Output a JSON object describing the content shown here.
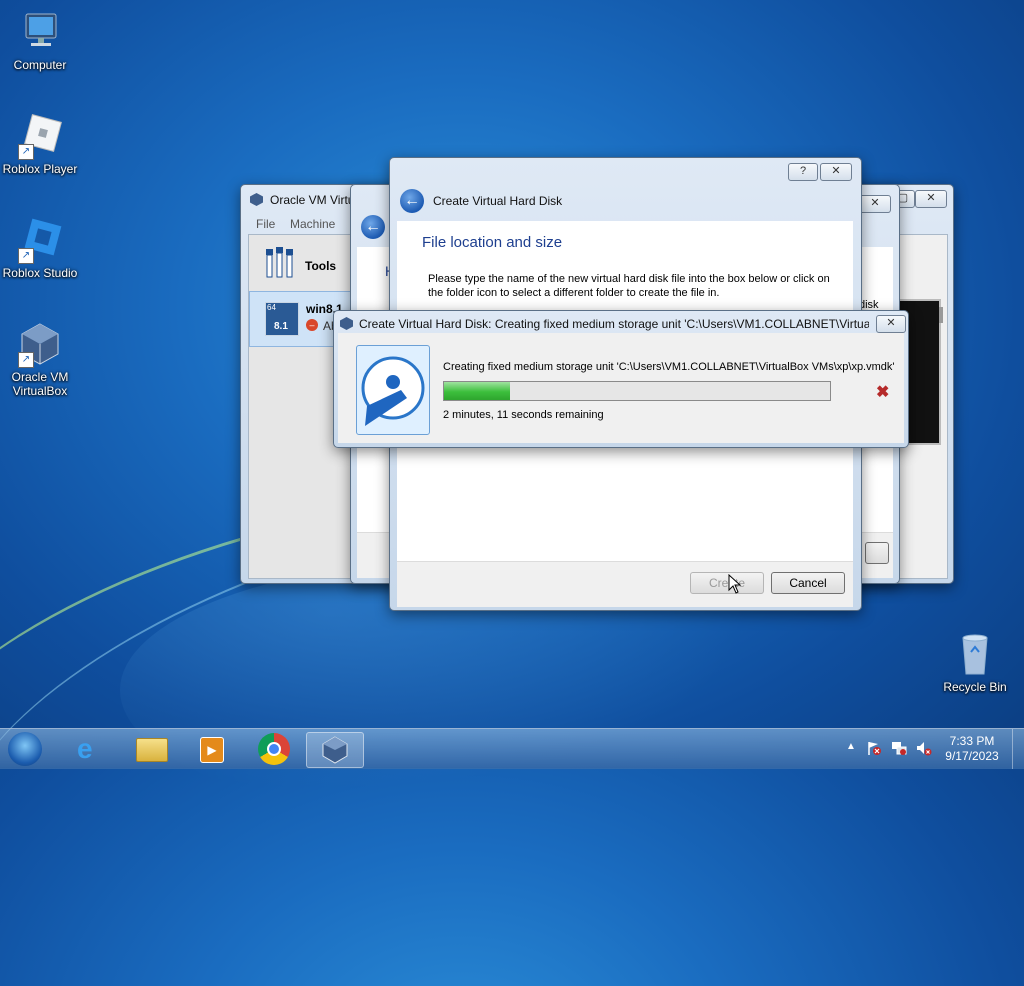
{
  "desktop": {
    "icons": [
      {
        "label": "Computer"
      },
      {
        "label": "Roblox Player"
      },
      {
        "label": "Roblox Studio"
      },
      {
        "label": "Oracle VM VirtualBox"
      },
      {
        "label": "Recycle Bin"
      }
    ]
  },
  "vbox_main": {
    "title": "Oracle VM Virtu",
    "menu": [
      "File",
      "Machine"
    ],
    "tools_label": "Tools",
    "vm_name": "win8.1",
    "vm_badge_top": "64",
    "vm_badge_bottom": "8.1",
    "vm_status": "Ab"
  },
  "wizard_behind": {
    "heading_partial": "H",
    "right_partial": "disk"
  },
  "wizard": {
    "title": "Create Virtual Hard Disk",
    "heading": "File location and size",
    "description": "Please type the name of the new virtual hard disk file into the box below or click on the folder icon to select a different folder to create the file in.",
    "help_btn": "?",
    "create_btn": "Create",
    "cancel_btn": "Cancel"
  },
  "progress": {
    "title": "Create Virtual Hard Disk: Creating fixed medium storage unit 'C:\\Users\\VM1.COLLABNET\\Virtua...",
    "message": "Creating fixed medium storage unit 'C:\\Users\\VM1.COLLABNET\\VirtualBox VMs\\xp\\xp.vmdk' ...",
    "remaining": "2 minutes, 11 seconds remaining",
    "percent": 17
  },
  "taskbar": {
    "time": "7:33 PM",
    "date": "9/17/2023",
    "pinned": [
      "start-orb",
      "internet-explorer",
      "file-explorer",
      "media-player",
      "chrome",
      "virtualbox"
    ]
  },
  "colors": {
    "accent": "#1a6cc0",
    "progress_fill": "#3cbf3c",
    "heading_blue": "#1e3f8f"
  }
}
